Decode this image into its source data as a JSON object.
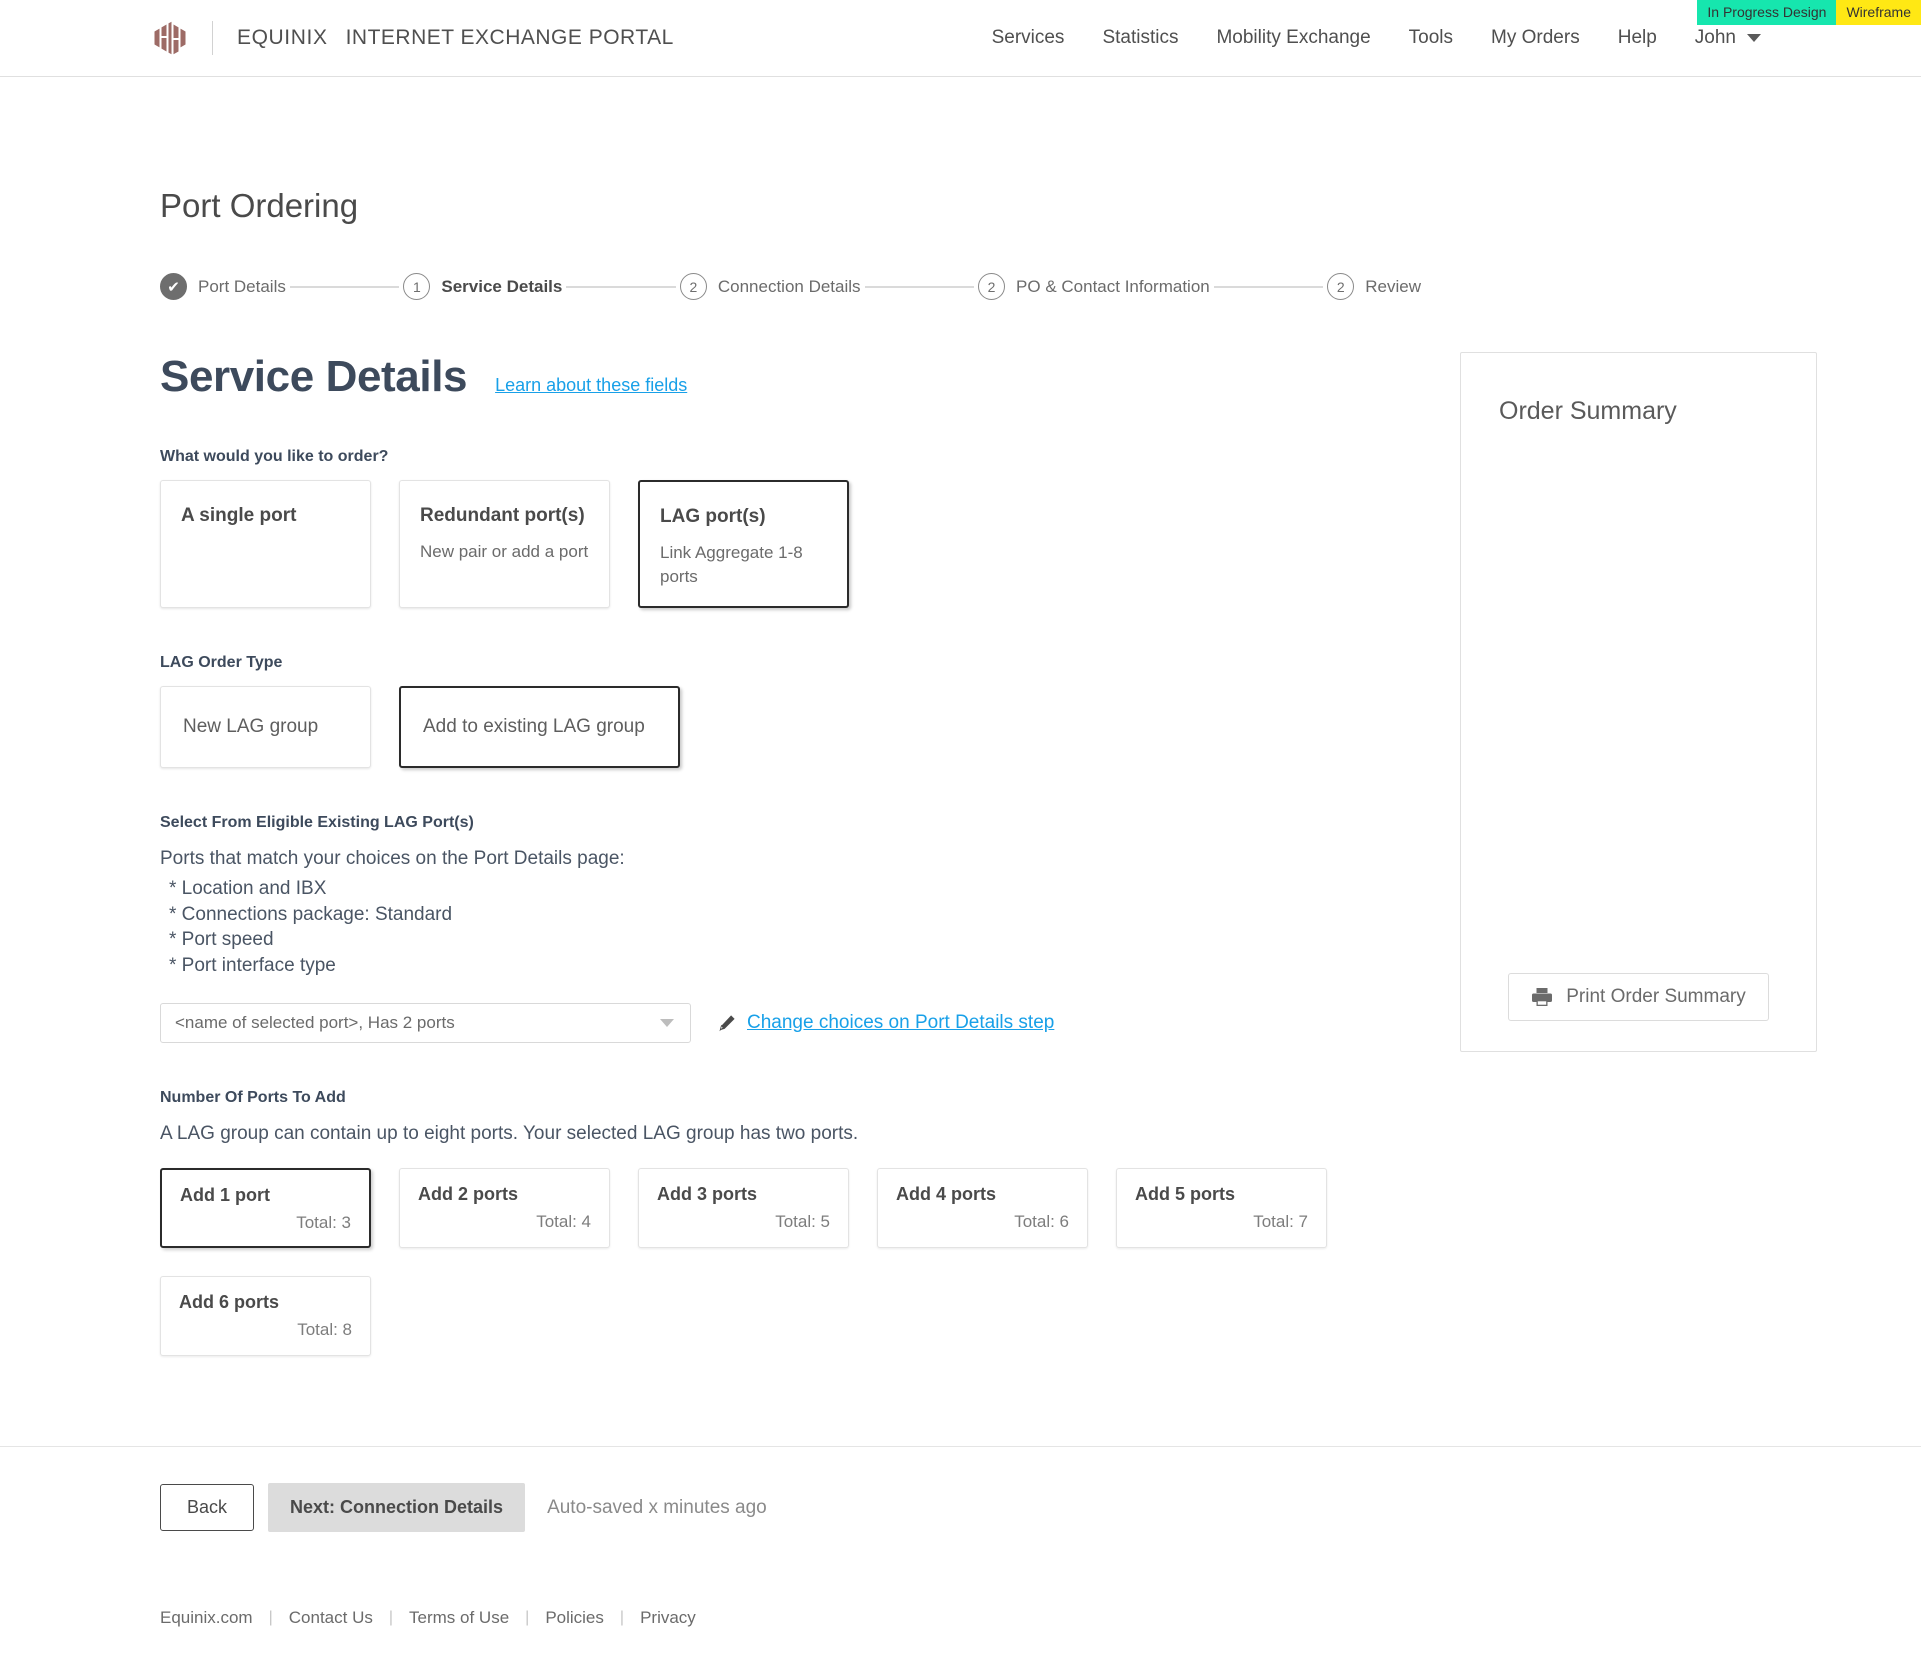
{
  "badges": [
    {
      "label": "In Progress Design",
      "color": "#16e6ae"
    },
    {
      "label": "Wireframe",
      "color": "#ffe814"
    }
  ],
  "header": {
    "logo_icon": "equinix-logo-icon",
    "brand": "EQUINIX",
    "product": "INTERNET EXCHANGE PORTAL",
    "nav": [
      {
        "label": "Services"
      },
      {
        "label": "Statistics"
      },
      {
        "label": "Mobility Exchange"
      },
      {
        "label": "Tools"
      },
      {
        "label": "My Orders"
      },
      {
        "label": "Help"
      }
    ],
    "user": {
      "name": "John",
      "caret_icon": "chevron-down-icon"
    }
  },
  "page": {
    "title": "Port Ordering"
  },
  "stepper": {
    "steps": [
      {
        "marker": "✔",
        "label": "Port Details",
        "state": "done"
      },
      {
        "marker": "1",
        "label": "Service Details",
        "state": "current"
      },
      {
        "marker": "2",
        "label": "Connection Details",
        "state": "upcoming"
      },
      {
        "marker": "2",
        "label": "PO & Contact Information",
        "state": "upcoming"
      },
      {
        "marker": "2",
        "label": "Review",
        "state": "upcoming"
      }
    ]
  },
  "service_details": {
    "title": "Service Details",
    "learn_link": "Learn about these fields",
    "order_question_label": "What would you like to order?",
    "order_options": [
      {
        "title": "A single port",
        "sub": "",
        "selected": false
      },
      {
        "title": "Redundant port(s)",
        "sub": "New pair or add a port",
        "selected": false
      },
      {
        "title": "LAG port(s)",
        "sub": "Link Aggregate 1-8 ports",
        "selected": true
      }
    ],
    "lag_order_type_label": "LAG Order Type",
    "lag_order_types": [
      {
        "title": "New LAG group",
        "selected": false
      },
      {
        "title": "Add to existing LAG group",
        "selected": true
      }
    ],
    "eligible_label": "Select From Eligible Existing LAG Port(s)",
    "eligible_intro": "Ports that match your choices on the Port Details page:",
    "eligible_criteria": [
      "* Location and IBX",
      "* Connections package: Standard",
      "* Port speed",
      "* Port interface type"
    ],
    "port_select": {
      "value": "<name of selected port>, Has 2 ports",
      "caret_icon": "chevron-down-icon"
    },
    "change_choices": {
      "icon": "pencil-edit-icon",
      "label": "Change choices on Port Details step"
    },
    "ports_to_add_label": "Number Of Ports To Add",
    "ports_to_add_help": "A LAG group can contain up to eight ports. Your selected LAG group has two ports.",
    "port_count_options": [
      {
        "title": "Add 1 port",
        "total": "Total: 3",
        "selected": true
      },
      {
        "title": "Add 2 ports",
        "total": "Total: 4",
        "selected": false
      },
      {
        "title": "Add 3 ports",
        "total": "Total: 5",
        "selected": false
      },
      {
        "title": "Add 4 ports",
        "total": "Total: 6",
        "selected": false
      },
      {
        "title": "Add 5 ports",
        "total": "Total: 7",
        "selected": false
      },
      {
        "title": "Add 6 ports",
        "total": "Total: 8",
        "selected": false
      }
    ]
  },
  "order_summary": {
    "title": "Order Summary",
    "print_button": {
      "icon": "printer-icon",
      "label": "Print Order Summary"
    }
  },
  "actions": {
    "back_label": "Back",
    "next_label": "Next: Connection Details",
    "autosave": "Auto-saved x minutes ago"
  },
  "footer": {
    "links": [
      {
        "label": "Equinix.com"
      },
      {
        "label": "Contact Us"
      },
      {
        "label": "Terms of Use"
      },
      {
        "label": "Policies"
      },
      {
        "label": "Privacy"
      }
    ],
    "separator": "|"
  }
}
